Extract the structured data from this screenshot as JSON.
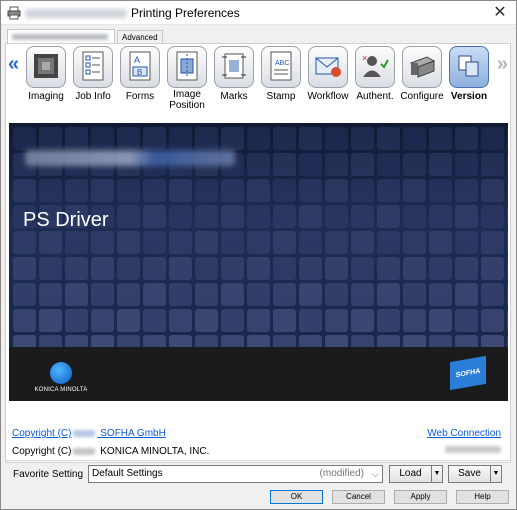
{
  "window": {
    "title": "Printing Preferences",
    "close_glyph": "✕"
  },
  "tabs": [
    {
      "label": ""
    },
    {
      "label": "Advanced"
    }
  ],
  "toolbar": {
    "items": [
      {
        "label": "Imaging",
        "icon": "imaging-icon"
      },
      {
        "label": "Job Info",
        "icon": "job-info-icon"
      },
      {
        "label": "Forms",
        "icon": "forms-icon"
      },
      {
        "label": "Image\nPosition",
        "icon": "image-position-icon"
      },
      {
        "label": "Marks",
        "icon": "marks-icon"
      },
      {
        "label": "Stamp",
        "icon": "stamp-icon"
      },
      {
        "label": "Workflow",
        "icon": "workflow-icon"
      },
      {
        "label": "Authent.",
        "icon": "authentication-icon"
      },
      {
        "label": "Configure",
        "icon": "configure-icon"
      },
      {
        "label": "Version",
        "icon": "version-icon",
        "selected": true
      }
    ],
    "prev_glyph": "«",
    "next_glyph": "»"
  },
  "banner": {
    "heading": "PS Driver",
    "brand_text": "KONICA MINOLTA",
    "sofha_text": "SOFHA"
  },
  "info": {
    "copyright1_prefix": "Copyright (C)",
    "copyright1_company": "SOFHA GmbH",
    "copyright2_prefix": "Copyright (C)",
    "copyright2_company": "KONICA MINOLTA, INC.",
    "web_connection": "Web Connection"
  },
  "favorite": {
    "label": "Favorite Setting",
    "value": "Default Settings",
    "state": "(modified)",
    "load_label": "Load",
    "save_label": "Save"
  },
  "buttons": {
    "ok": "OK",
    "cancel": "Cancel",
    "apply": "Apply",
    "help": "Help"
  }
}
